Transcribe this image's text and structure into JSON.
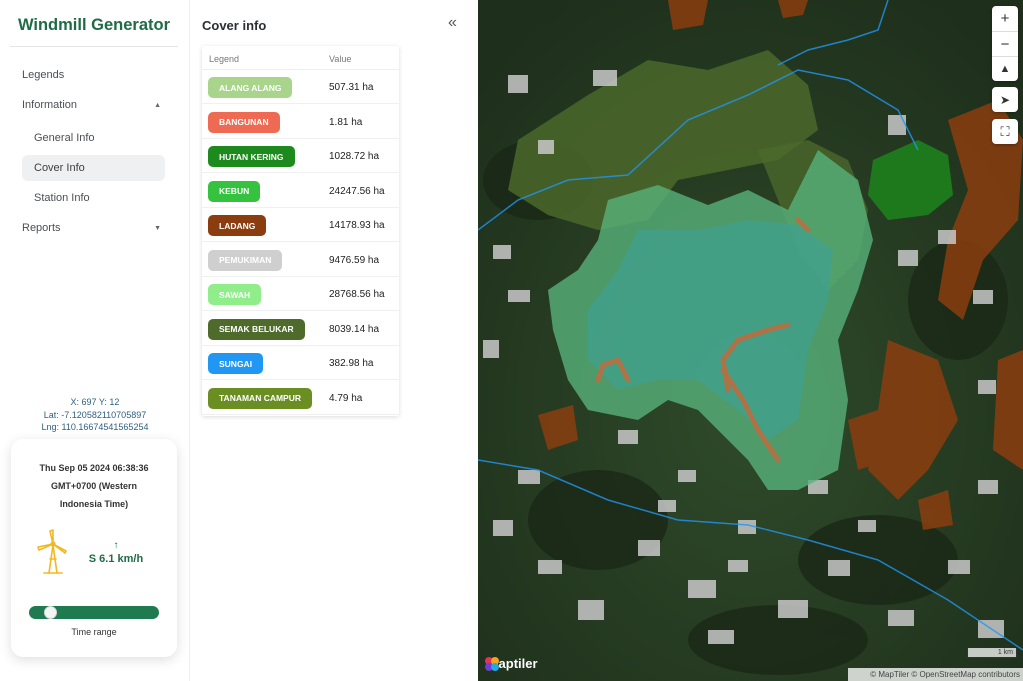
{
  "app": {
    "title": "Windmill Generator"
  },
  "nav": {
    "legends": "Legends",
    "information": "Information",
    "general_info": "General Info",
    "cover_info": "Cover Info",
    "station_info": "Station Info",
    "reports": "Reports"
  },
  "cursor": {
    "xy": "X: 697 Y: 12",
    "lat": "Lat: -7.120582110705897",
    "lng": "Lng: 110.16674541565254"
  },
  "weather": {
    "date_line1": "Thu Sep 05 2024 06:38:36",
    "date_line2": "GMT+0700 (Western",
    "date_line3": "Indonesia Time)",
    "wind_arrow": "↑",
    "wind": "S 6.1 km/h",
    "time_range_label": "Time range",
    "time_range_value": 0.13
  },
  "panel": {
    "title": "Cover info",
    "collapse_icon": "«",
    "col_legend": "Legend",
    "col_value": "Value",
    "rows": [
      {
        "label": "ALANG ALANG",
        "value": "507.31 ha",
        "color": "#a8d58b"
      },
      {
        "label": "BANGUNAN",
        "value": "1.81 ha",
        "color": "#ef6a52"
      },
      {
        "label": "HUTAN KERING",
        "value": "1028.72 ha",
        "color": "#1d8a1d"
      },
      {
        "label": "KEBUN",
        "value": "24247.56 ha",
        "color": "#34c23f"
      },
      {
        "label": "LADANG",
        "value": "14178.93 ha",
        "color": "#8b3d0f"
      },
      {
        "label": "PEMUKIMAN",
        "value": "9476.59 ha",
        "color": "#cfcfcf"
      },
      {
        "label": "SAWAH",
        "value": "28768.56 ha",
        "color": "#90ee8a"
      },
      {
        "label": "SEMAK BELUKAR",
        "value": "8039.14 ha",
        "color": "#4e6b2c"
      },
      {
        "label": "SUNGAI",
        "value": "382.98 ha",
        "color": "#2196f3"
      },
      {
        "label": "TANAMAN CAMPUR",
        "value": "4.79 ha",
        "color": "#6b8e23"
      }
    ]
  },
  "map": {
    "zoom_in": "+",
    "zoom_out": "−",
    "compass": "▲",
    "locate": "➤",
    "fullscreen": "⛶",
    "logo_text": "maptiler",
    "scale": "1 km",
    "attribution": "© MapTiler © OpenStreetMap contributors"
  }
}
